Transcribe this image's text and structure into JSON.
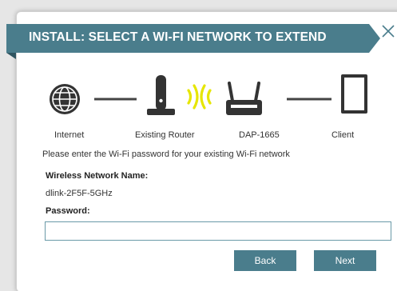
{
  "dialog": {
    "title": "INSTALL: SELECT A WI-FI NETWORK TO EXTEND",
    "close_icon": "close-icon",
    "accent_color": "#4a7d8c"
  },
  "diagram": {
    "nodes": [
      {
        "label": "Internet",
        "icon": "globe-icon"
      },
      {
        "label": "Existing Router",
        "icon": "router-icon"
      },
      {
        "label": "DAP-1665",
        "icon": "extender-icon"
      },
      {
        "label": "Client",
        "icon": "tablet-icon"
      }
    ],
    "signal_icon": "wifi-signal-icon",
    "signal_color": "#e6e600"
  },
  "form": {
    "intro": "Please enter the Wi-Fi password for your existing Wi-Fi network",
    "network_name_label": "Wireless Network Name:",
    "network_name_value": "dlink-2F5F-5GHz",
    "password_label": "Password:",
    "password_value": ""
  },
  "buttons": {
    "back": "Back",
    "next": "Next"
  }
}
